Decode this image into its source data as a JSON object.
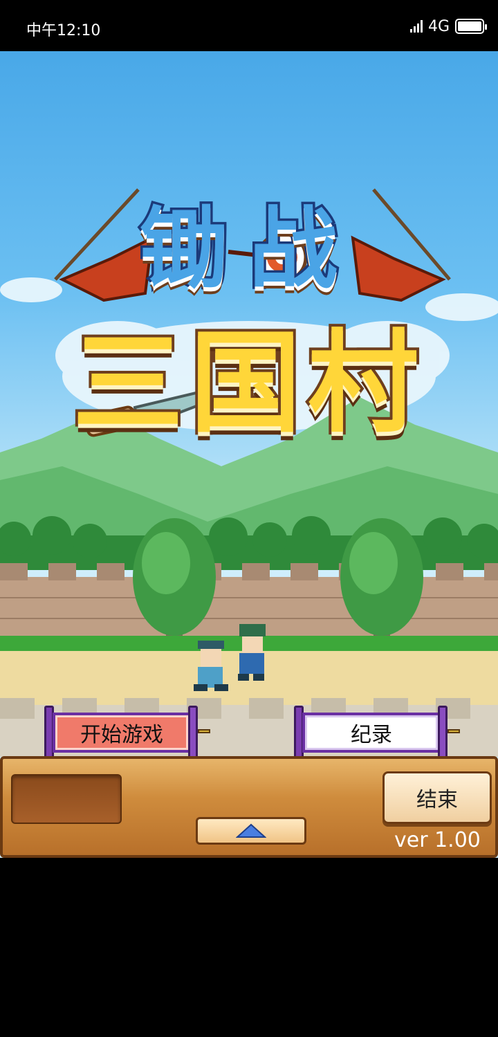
{
  "status_bar": {
    "time": "中午12:10",
    "network": "4G"
  },
  "game": {
    "logo_line1": "锄战",
    "logo_line2": "三国村"
  },
  "menu": {
    "start_label": "开始游戏",
    "record_label": "纪录",
    "end_label": "结束",
    "version": "ver 1.00"
  },
  "colors": {
    "sky": "#49a8e8",
    "grass": "#3da83a",
    "road": "#eedba0",
    "start_button": "#f07a6a",
    "scroll_rod": "#7a3db0",
    "panel_wood": "#cf8c3d"
  },
  "icons": {
    "up_arrow": "up-arrow-icon",
    "signal": "signal-icon",
    "battery": "battery-icon"
  }
}
